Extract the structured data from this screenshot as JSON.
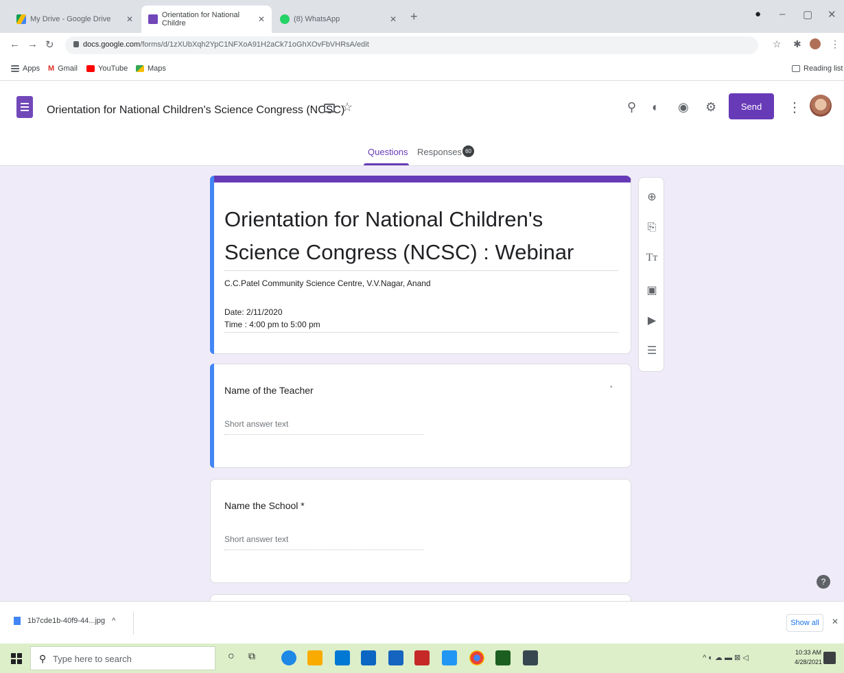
{
  "browser": {
    "tabs": [
      {
        "title": "My Drive - Google Drive"
      },
      {
        "title": "Orientation for National Childre"
      },
      {
        "title": "(8) WhatsApp"
      }
    ],
    "url_host": "docs.google.com",
    "url_path": "/forms/d/1zXUbXqh2YpC1NFXoA91H2aCk71oGhXOvFbVHRsA/edit",
    "bookmarks": [
      "Apps",
      "Gmail",
      "YouTube",
      "Maps"
    ],
    "reading_list": "Reading list"
  },
  "form_header": {
    "doc_title": "Orientation for National Children's Science Congress (NCSC)",
    "send_label": "Send",
    "tabs": {
      "questions": "Questions",
      "responses": "Responses"
    },
    "responses_count": "60"
  },
  "title_card": {
    "title": "Orientation for National Children's  Science Congress (NCSC) : Webinar",
    "description": "C.C.Patel Community Science Centre, V.V.Nagar, Anand",
    "date": "Date: 2/11/2020",
    "time": "Time : 4:00 pm to 5:00 pm"
  },
  "questions": [
    {
      "title": "Name of the Teacher",
      "placeholder": "Short answer text"
    },
    {
      "title": "Name  the School *",
      "placeholder": "Short answer text"
    }
  ],
  "download_shelf": {
    "file_name": "1b7cde1b-40f9-44...jpg",
    "show_all": "Show all"
  },
  "taskbar": {
    "search_placeholder": "Type here to search",
    "time": "10:33 AM",
    "date": "4/28/2021"
  },
  "colors": {
    "forms_purple": "#673ab7",
    "canvas_bg": "#f0ebf8",
    "active_blue": "#4285f4"
  }
}
